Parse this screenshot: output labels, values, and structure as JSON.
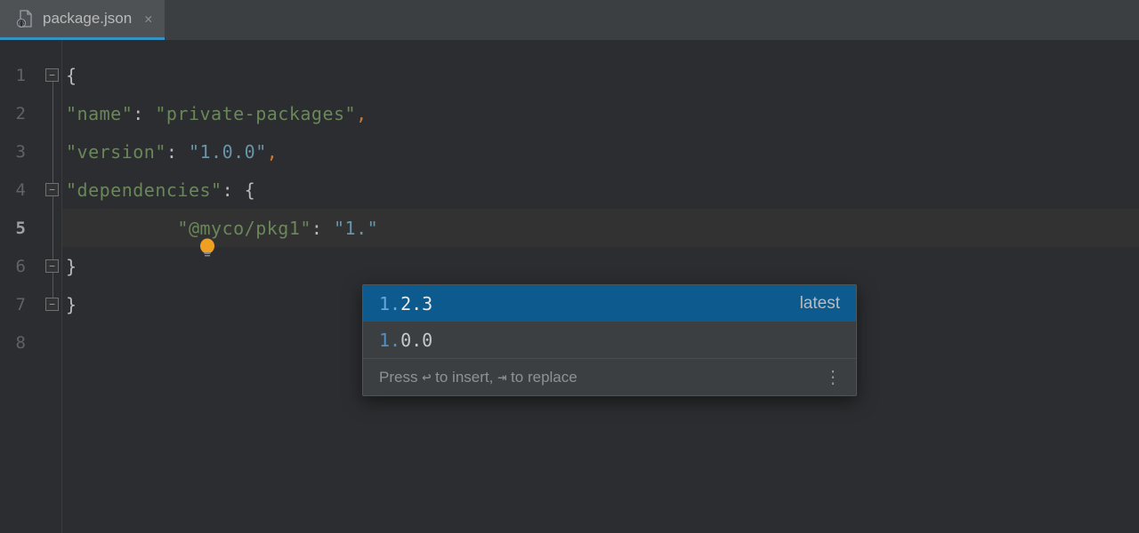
{
  "tab": {
    "label": "package.json"
  },
  "lineNumbers": [
    "1",
    "2",
    "3",
    "4",
    "5",
    "6",
    "7",
    "8"
  ],
  "activeLine": 5,
  "code": {
    "name_key": "\"name\"",
    "name_val": "\"private-packages\"",
    "version_key": "\"version\"",
    "version_val": "\"1.0.0\"",
    "deps_key": "\"dependencies\"",
    "pkg_key": "\"@myco/pkg1\"",
    "pkg_val": "\"1.\""
  },
  "autocomplete": {
    "items": [
      {
        "prefix": "1.",
        "rest": "2.3",
        "tag": "latest",
        "selected": true
      },
      {
        "prefix": "1.",
        "rest": "0.0",
        "tag": "",
        "selected": false
      }
    ],
    "hint_prefix": "Press ",
    "hint_sym1": "↩",
    "hint_mid": " to insert, ",
    "hint_sym2": "⇥",
    "hint_suffix": " to replace"
  }
}
